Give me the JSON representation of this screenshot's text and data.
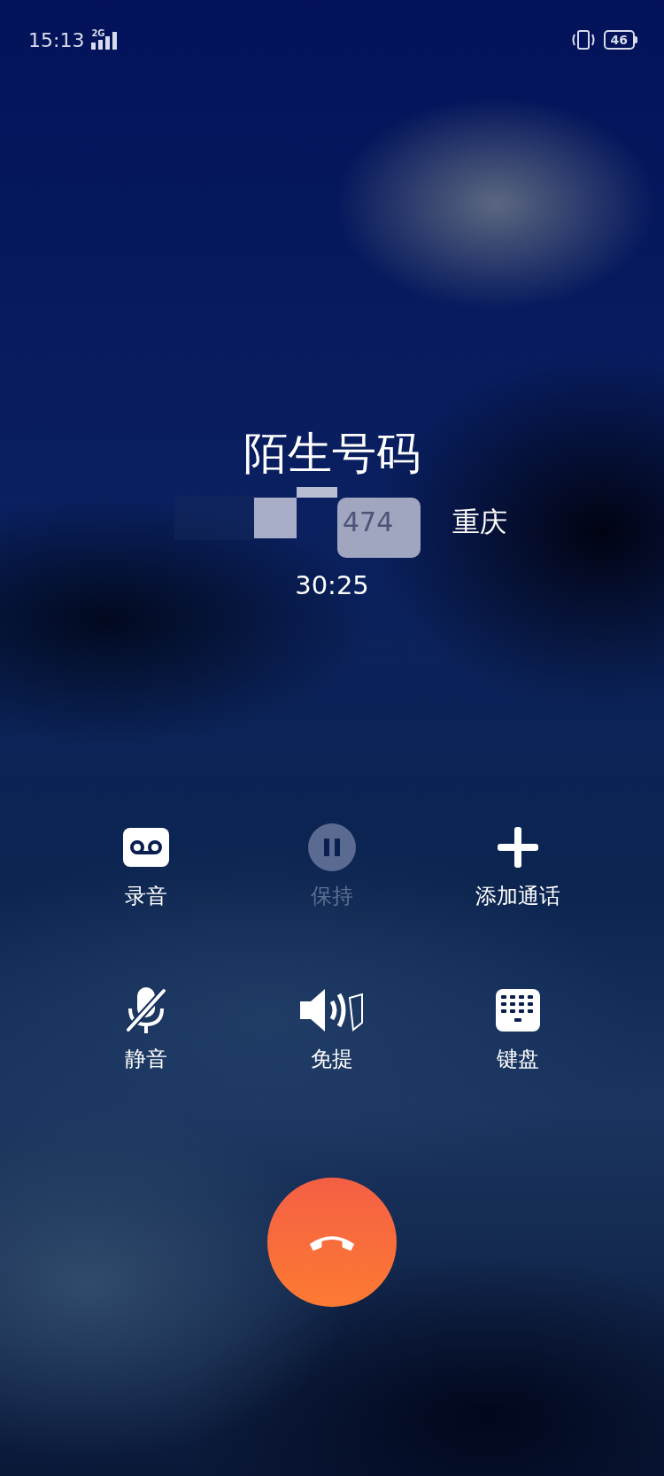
{
  "status_bar": {
    "time": "15:13",
    "network": "2G",
    "battery": "46"
  },
  "caller": {
    "name": "陌生号码",
    "number": "474",
    "location": "重庆",
    "duration": "30:25"
  },
  "controls": [
    {
      "kind": "record",
      "label": "录音",
      "disabled": false
    },
    {
      "kind": "hold",
      "label": "保持",
      "disabled": true
    },
    {
      "kind": "add",
      "label": "添加通话",
      "disabled": false
    },
    {
      "kind": "mute",
      "label": "静音",
      "disabled": false
    },
    {
      "kind": "speaker",
      "label": "免提",
      "disabled": false
    },
    {
      "kind": "keypad",
      "label": "键盘",
      "disabled": false
    }
  ],
  "end_call": {
    "kind": "hangup"
  }
}
